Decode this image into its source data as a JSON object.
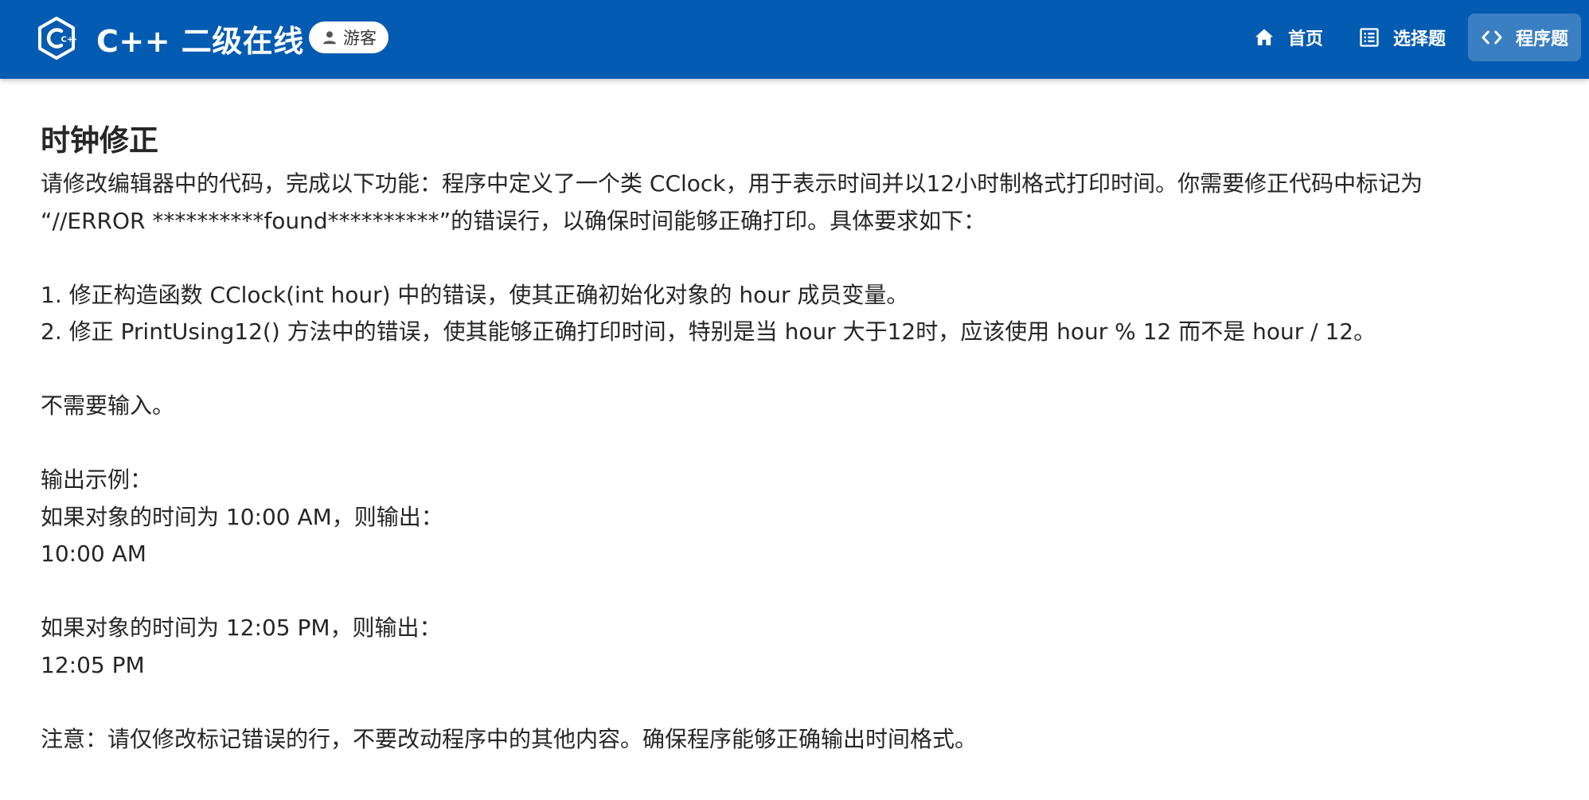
{
  "header": {
    "brand_title": "C++ 二级在线",
    "logo_label": "C++",
    "guest_label": "游客",
    "nav": [
      {
        "label": "首页",
        "icon": "home-icon"
      },
      {
        "label": "选择题",
        "icon": "list-icon"
      },
      {
        "label": "程序题",
        "icon": "code-icon",
        "active": true
      }
    ],
    "colors": {
      "bar": "#045bb2",
      "text": "#ffffff"
    }
  },
  "problem": {
    "title": "时钟修正",
    "description": "请修改编辑器中的代码，完成以下功能：程序中定义了一个类 CClock，用于表示时间并以12小时制格式打印时间。你需要修正代码中标记为\n“//ERROR **********found**********”的错误行，以确保时间能够正确打印。具体要求如下：\n\n1. 修正构造函数 CClock(int hour) 中的错误，使其正确初始化对象的 hour 成员变量。\n2. 修正 PrintUsing12() 方法中的错误，使其能够正确打印时间，特别是当 hour 大于12时，应该使用 hour % 12 而不是 hour / 12。\n\n不需要输入。\n\n输出示例：\n如果对象的时间为 10:00 AM，则输出：\n10:00 AM\n\n如果对象的时间为 12:05 PM，则输出：\n12:05 PM\n\n注意：请仅修改标记错误的行，不要改动程序中的其他内容。确保程序能够正确输出时间格式。"
  }
}
